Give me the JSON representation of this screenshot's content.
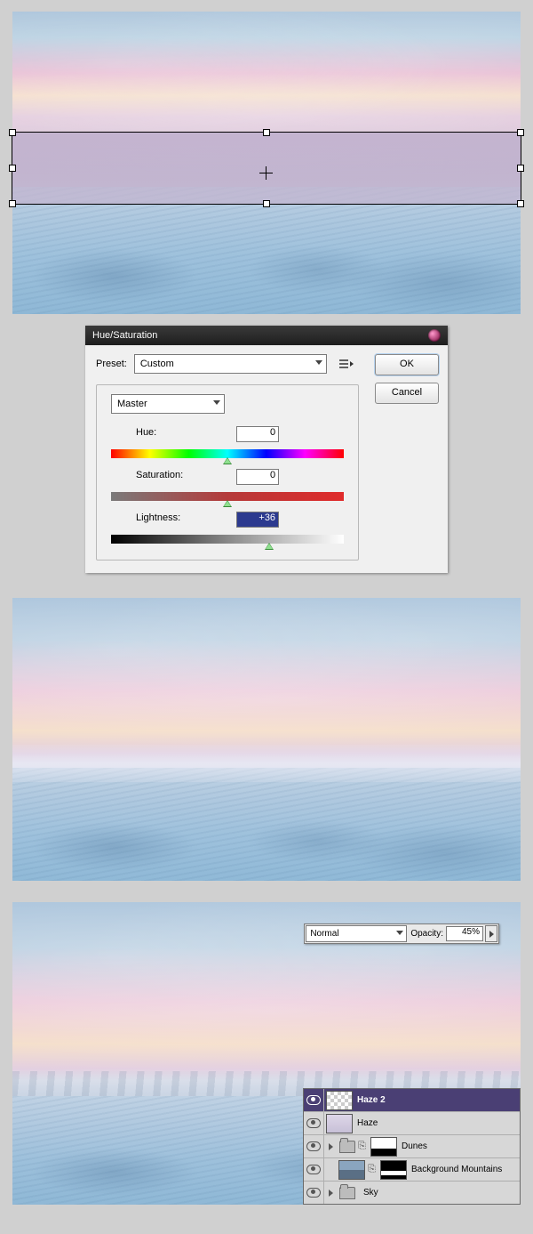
{
  "dialog": {
    "title": "Hue/Saturation",
    "preset_label": "Preset:",
    "preset_value": "Custom",
    "ok": "OK",
    "cancel": "Cancel",
    "channel": "Master",
    "hue_label": "Hue:",
    "hue_value": "0",
    "sat_label": "Saturation:",
    "sat_value": "0",
    "light_label": "Lightness:",
    "light_value": "+36"
  },
  "blend": {
    "mode": "Normal",
    "opacity_label": "Opacity:",
    "opacity_value": "45%"
  },
  "layers": [
    {
      "name": "Haze 2"
    },
    {
      "name": "Haze"
    },
    {
      "name": "Dunes"
    },
    {
      "name": "Background Mountains"
    },
    {
      "name": "Sky"
    }
  ]
}
